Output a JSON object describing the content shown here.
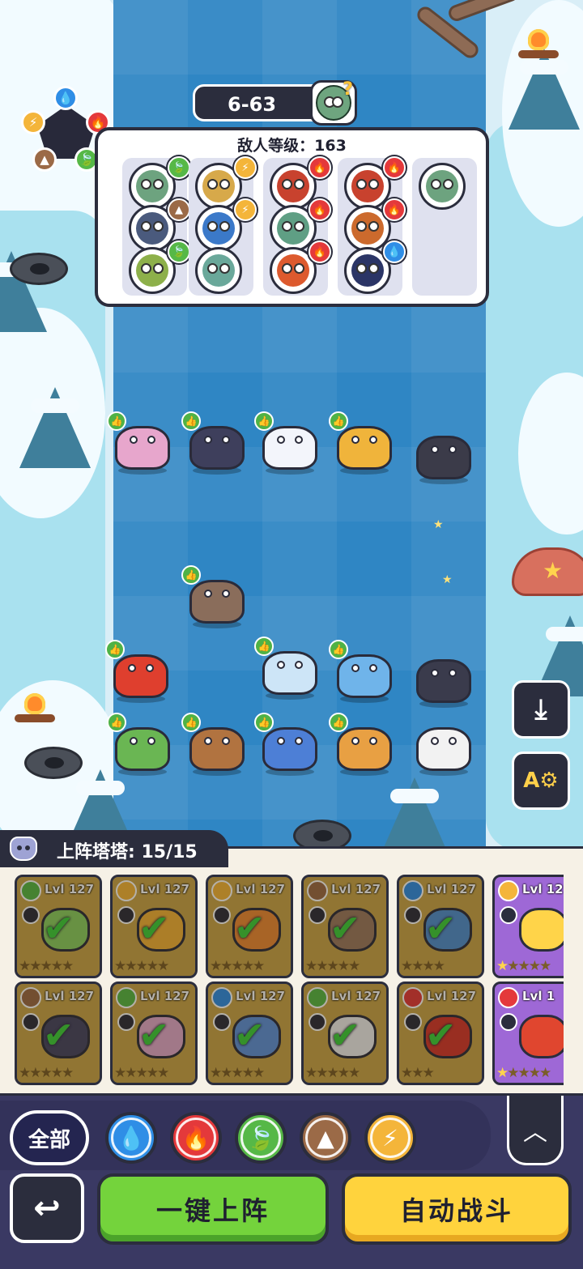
{
  "stage": {
    "label": "6-63"
  },
  "enemy_panel": {
    "title": "敌人等级：163",
    "columns": [
      [
        {
          "face": "#6da37f",
          "element": "leaf"
        },
        {
          "face": "#4a5a7d",
          "element": "rock"
        },
        {
          "face": "#8db04a",
          "element": "leaf"
        }
      ],
      [
        {
          "face": "#d7a94a",
          "element": "thunder"
        },
        {
          "face": "#3b79c9",
          "element": "thunder"
        },
        {
          "face": "#6aa89a",
          "element": ""
        }
      ],
      [
        {
          "face": "#c8422e",
          "element": "fire"
        },
        {
          "face": "#5f9f84",
          "element": "fire"
        },
        {
          "face": "#dd5a2e",
          "element": "fire"
        }
      ],
      [
        {
          "face": "#c8422e",
          "element": "fire"
        },
        {
          "face": "#cc6a2d",
          "element": "fire"
        },
        {
          "face": "#2b3566",
          "element": "water"
        }
      ],
      [
        {
          "face": "#6da37f",
          "element": ""
        }
      ]
    ]
  },
  "elements": {
    "water": {
      "color": "#2f8ee6",
      "icon": "water-drop-icon",
      "glyph": "💧"
    },
    "fire": {
      "color": "#e4393b",
      "icon": "flame-icon",
      "glyph": "🔥"
    },
    "leaf": {
      "color": "#56b847",
      "icon": "leaf-icon",
      "glyph": "🍃"
    },
    "rock": {
      "color": "#9b6a47",
      "icon": "mountain-icon",
      "glyph": "▲"
    },
    "thunder": {
      "color": "#f4b53a",
      "icon": "lightning-icon",
      "glyph": "⚡"
    }
  },
  "units": [
    {
      "name": "unit-mantis",
      "color": "#e7a6cc"
    },
    {
      "name": "unit-gator",
      "color": "#3e3f5c"
    },
    {
      "name": "unit-polar-bear",
      "color": "#f3f5fb"
    },
    {
      "name": "unit-lion",
      "color": "#f0b43b"
    },
    {
      "name": "unit-tanuki",
      "color": "#3b3b49"
    },
    {
      "name": "unit-monkey",
      "color": "#8a6d5b"
    },
    {
      "name": "unit-red-lizard",
      "color": "#df3f2e"
    },
    {
      "name": "unit-blue-raccoon",
      "color": "#cde5f7"
    },
    {
      "name": "unit-blue-cat",
      "color": "#6fb4ea"
    },
    {
      "name": "unit-red-fox",
      "color": "#3a3b4c"
    },
    {
      "name": "unit-leaf-cat",
      "color": "#6ab653"
    },
    {
      "name": "unit-snail",
      "color": "#b17340"
    },
    {
      "name": "unit-blue-ghost",
      "color": "#4d7fd6"
    },
    {
      "name": "unit-antler-deer",
      "color": "#e8a043"
    },
    {
      "name": "unit-panda",
      "color": "#f2f2f2"
    }
  ],
  "roster": {
    "label": "上阵塔塔: 15/15",
    "cards": [
      {
        "lvl": "Lvl 127",
        "element": "leaf",
        "pet": "#8ad063",
        "stars": "★★★★★",
        "gold": 0,
        "selected": true,
        "legendary": false
      },
      {
        "lvl": "Lvl 127",
        "element": "thunder",
        "pet": "#f3b33a",
        "stars": "★★★★★",
        "gold": 0,
        "selected": true,
        "legendary": false
      },
      {
        "lvl": "Lvl 127",
        "element": "thunder",
        "pet": "#ed8a37",
        "stars": "★★★★★",
        "gold": 0,
        "selected": true,
        "legendary": false
      },
      {
        "lvl": "Lvl 127",
        "element": "rock",
        "pet": "#9b7a62",
        "stars": "★★★★★",
        "gold": 0,
        "selected": true,
        "legendary": false
      },
      {
        "lvl": "Lvl 127",
        "element": "water",
        "pet": "#4f8fd2",
        "stars": "★★★★",
        "gold": 0,
        "selected": true,
        "legendary": false
      },
      {
        "lvl": "Lvl 12",
        "element": "thunder",
        "pet": "#ffd449",
        "stars": "★★★★★",
        "gold": 1,
        "selected": false,
        "legendary": true
      },
      {
        "lvl": "Lvl 127",
        "element": "rock",
        "pet": "#454565",
        "stars": "★★★★★",
        "gold": 0,
        "selected": true,
        "legendary": false
      },
      {
        "lvl": "Lvl 127",
        "element": "leaf",
        "pet": "#e2a9cd",
        "stars": "★★★★★",
        "gold": 0,
        "selected": true,
        "legendary": false
      },
      {
        "lvl": "Lvl 127",
        "element": "water",
        "pet": "#5e93dc",
        "stars": "★★★★★",
        "gold": 0,
        "selected": true,
        "legendary": false
      },
      {
        "lvl": "Lvl 127",
        "element": "leaf",
        "pet": "#efefef",
        "stars": "★★★★★",
        "gold": 0,
        "selected": true,
        "legendary": false
      },
      {
        "lvl": "Lvl 127",
        "element": "fire",
        "pet": "#d6382e",
        "stars": "★★★",
        "gold": 0,
        "selected": true,
        "legendary": false
      },
      {
        "lvl": "Lvl 1",
        "element": "fire",
        "pet": "#e0462f",
        "stars": "★★★★★",
        "gold": 1,
        "selected": false,
        "legendary": true
      }
    ]
  },
  "filters": {
    "all_label": "全部",
    "chips": [
      "water",
      "fire",
      "leaf",
      "rock",
      "thunder"
    ]
  },
  "buttons": {
    "one_click_deploy": "一键上阵",
    "auto_battle": "自动战斗",
    "back_glyph": "↩",
    "collapse_glyph": "︿",
    "auto_arrange_glyph": "⤓",
    "auto_skill_glyph": "A⚙"
  }
}
